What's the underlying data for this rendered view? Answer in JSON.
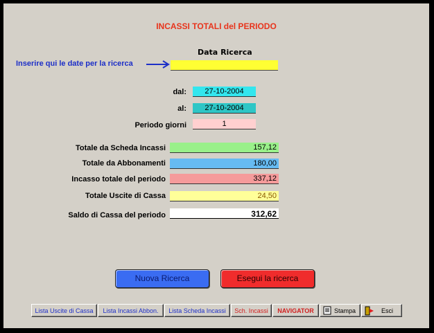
{
  "form": {
    "title": "INCASSI TOTALI del PERIODO",
    "search_header": "Data  Ricerca",
    "instruction": "Inserire qui le date per la ricerca",
    "date_search_value": "",
    "dal_label": "dal:",
    "dal_value": "27-10-2004",
    "al_label": "al:",
    "al_value": "27-10-2004",
    "periodo_label": "Periodo giorni",
    "periodo_value": "1"
  },
  "totals": {
    "scheda_label": "Totale da Scheda Incassi",
    "scheda_value": "157,12",
    "abbonamenti_label": "Totale da Abbonamenti",
    "abbonamenti_value": "180,00",
    "incasso_label": "Incasso totale del periodo",
    "incasso_value": "337,12",
    "uscite_label": "Totale Uscite di Cassa",
    "uscite_value": "24,50",
    "saldo_label": "Saldo di Cassa del periodo",
    "saldo_value": "312,62"
  },
  "actions": {
    "new_search": "Nuova Ricerca",
    "run_search": "Esegui la ricerca"
  },
  "toolbar": {
    "lista_uscite": "Lista Uscite di Cassa",
    "lista_incassi_abbon": "Lista Incassi Abbon.",
    "lista_scheda_incassi": "Lista Scheda Incassi",
    "sch_incassi": "Sch. Incassi",
    "navigator": "NAVIGATOR",
    "stampa": "Stampa",
    "esci": "Esci"
  },
  "colors": {
    "title_red": "#e8341c",
    "instruction_blue": "#1d2fc8",
    "date_field_yellow": "#ffff33",
    "new_button_blue": "#3a6cf2",
    "run_button_red": "#f02c2c"
  }
}
